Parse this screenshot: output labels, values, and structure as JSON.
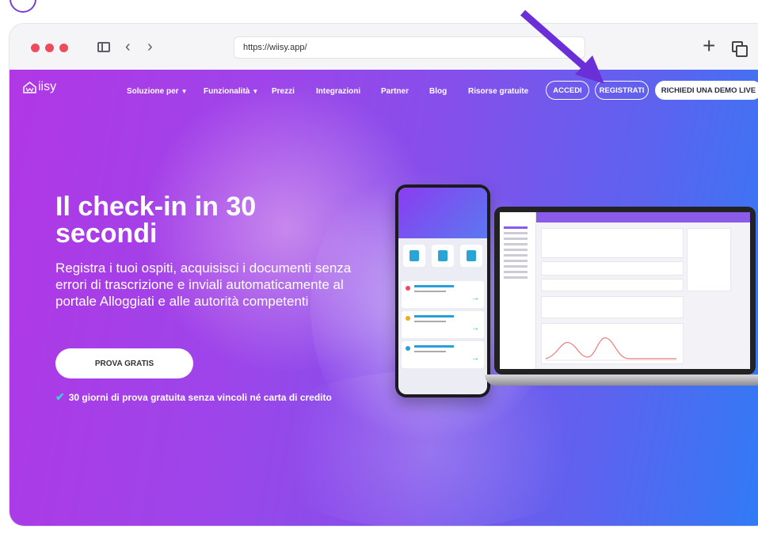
{
  "browser": {
    "url": "https://wiisy.app/"
  },
  "site": {
    "logo_text": "iisy",
    "nav": [
      {
        "label": "Soluzione per",
        "dropdown": true
      },
      {
        "label": "Funzionalità",
        "dropdown": true
      },
      {
        "label": "Prezzi",
        "dropdown": false
      },
      {
        "label": "Integrazioni",
        "dropdown": false
      },
      {
        "label": "Partner",
        "dropdown": false
      },
      {
        "label": "Blog",
        "dropdown": false
      },
      {
        "label": "Risorse gratuite",
        "dropdown": false
      }
    ],
    "buttons": {
      "login": "ACCEDI",
      "register": "REGISTRATI",
      "demo": "RICHIEDI UNA DEMO LIVE"
    }
  },
  "hero": {
    "title": "Il check-in in 30 secondi",
    "subtitle": "Registra i tuoi ospiti, acquisisci i documenti senza errori di trascrizione e inviali automaticamente al portale Alloggiati e alle autorità competenti",
    "cta": "PROVA GRATIS",
    "trial_note": "30 giorni di prova gratuita senza vincoli né carta di credito"
  },
  "icons": {
    "chevron": "chevron-down-icon",
    "check": "check-icon",
    "annotation_arrow": "arrow-icon"
  },
  "colors": {
    "accent": "#7a3fd6",
    "hero_start": "#b137e5",
    "hero_end": "#2e7cf6",
    "check": "#3cd0d6"
  }
}
